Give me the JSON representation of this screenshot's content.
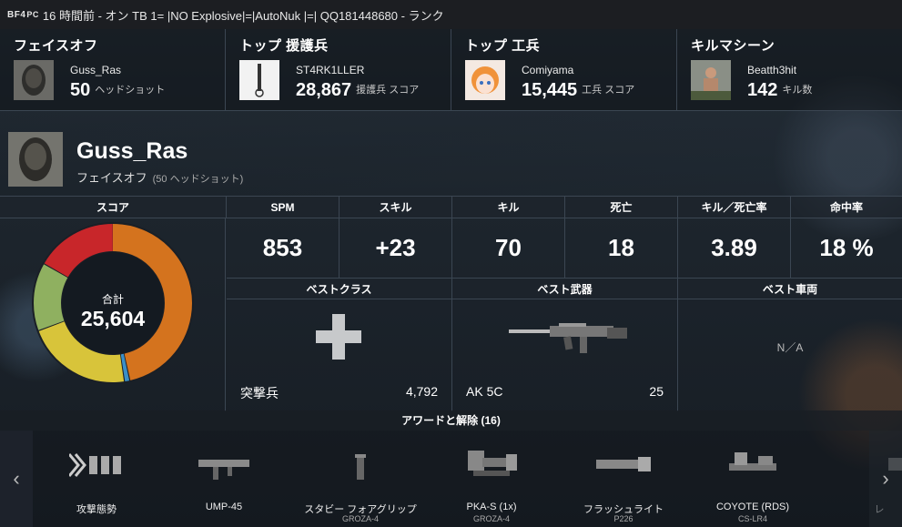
{
  "topbar": {
    "logo": "BF4",
    "platform": "PC",
    "text": "16 時間前 - オン TB 1= |NO Explosive|=|AutoNuk |=| QQ181448680 - ランク"
  },
  "heroes": [
    {
      "title": "フェイスオフ",
      "name": "Guss_Ras",
      "value": "50",
      "unit": "ヘッドショット"
    },
    {
      "title": "トップ 援護兵",
      "name": "ST4RK1LLER",
      "value": "28,867",
      "unit": "援護兵 スコア"
    },
    {
      "title": "トップ 工兵",
      "name": "Comiyama",
      "value": "15,445",
      "unit": "工兵 スコア"
    },
    {
      "title": "キルマシーン",
      "name": "Beatth3hit",
      "value": "142",
      "unit": "キル数"
    }
  ],
  "profile": {
    "name": "Guss_Ras",
    "subtitle": "フェイスオフ",
    "detail": "(50 ヘッドショット)"
  },
  "score": {
    "header": "スコア",
    "total_label": "合計",
    "total": "25,604"
  },
  "stats": [
    {
      "label": "SPM",
      "value": "853"
    },
    {
      "label": "スキル",
      "value": "+23"
    },
    {
      "label": "キル",
      "value": "70"
    },
    {
      "label": "死亡",
      "value": "18"
    },
    {
      "label": "キル／死亡率",
      "value": "3.89"
    },
    {
      "label": "命中率",
      "value": "18 %"
    }
  ],
  "best": {
    "class_header": "ベストクラス",
    "class_name": "突撃兵",
    "class_score": "4,792",
    "weapon_header": "ベスト武器",
    "weapon_name": "AK 5C",
    "weapon_kills": "25",
    "vehicle_header": "ベスト車両",
    "vehicle_value": "N／A"
  },
  "awards": {
    "header": "アワードと解除 (16)",
    "items": [
      {
        "title": "攻撃態勢",
        "sub": ""
      },
      {
        "title": "UMP-45",
        "sub": ""
      },
      {
        "title": "スタビー フォアグリップ",
        "sub": "GROZA-4"
      },
      {
        "title": "PKA-S (1x)",
        "sub": "GROZA-4"
      },
      {
        "title": "フラッシュライト",
        "sub": "P226"
      },
      {
        "title": "COYOTE (RDS)",
        "sub": "CS-LR4"
      },
      {
        "title": "レ",
        "sub": ""
      }
    ]
  },
  "icons": {
    "prev": "chevron-left-icon",
    "next": "chevron-right-icon"
  },
  "colors": {
    "donut": [
      "#d4731e",
      "#3a8fc8",
      "#d8c43a",
      "#8fb060",
      "#c8262a"
    ]
  }
}
